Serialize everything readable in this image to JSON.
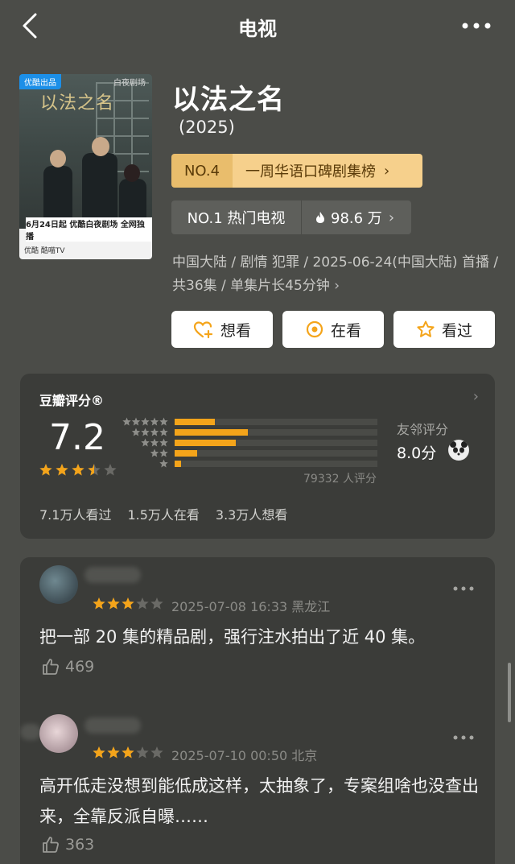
{
  "nav": {
    "title": "电视",
    "back_icon": "chevron-left-icon",
    "more_icon": "ellipsis-icon"
  },
  "poster": {
    "tag": "优酷出品",
    "logo": "白夜剧场",
    "title": "以法之名",
    "line1": "6月24日起  优酷白夜剧场  全网独播",
    "line2": "优酷   酷喵TV"
  },
  "show": {
    "title": "以法之名",
    "year": "(2025)"
  },
  "rank1": {
    "no": "NO.4",
    "text": "一周华语口碑剧集榜"
  },
  "rank2": {
    "text": "NO.1 热门电视",
    "heat": "98.6 万"
  },
  "meta": "中国大陆 / 剧情 犯罪 / 2025-06-24(中国大陆) 首播 / 共36集 / 单集片长45分钟",
  "buttons": {
    "want": "想看",
    "watching": "在看",
    "watched": "看过"
  },
  "rating": {
    "label": "豆瓣评分®",
    "score": "7.2",
    "stars": 3.5,
    "distribution": [
      0.2,
      0.36,
      0.3,
      0.11,
      0.03
    ],
    "votes": "79332 人评分",
    "friend_label": "友邻评分",
    "friend_score": "8.0分",
    "watched": "7.1万人看过",
    "watching": "1.5万人在看",
    "want": "3.3万人想看"
  },
  "comments": [
    {
      "stars": 3,
      "meta": "2025-07-08 16:33 黑龙江",
      "text": "把一部 20 集的精品剧，强行注水拍出了近 40 集。",
      "likes": "469"
    },
    {
      "stars": 3,
      "meta": "2025-07-10 00:50 北京",
      "text": "高开低走没想到能低成这样，太抽象了，专案组啥也没查出来，全靠反派自曝……",
      "likes": "363"
    }
  ],
  "colors": {
    "background": "#4b4c48",
    "card": "#3b3c39",
    "accent": "#f4a41a",
    "rank_gold": "#f6d08c"
  }
}
